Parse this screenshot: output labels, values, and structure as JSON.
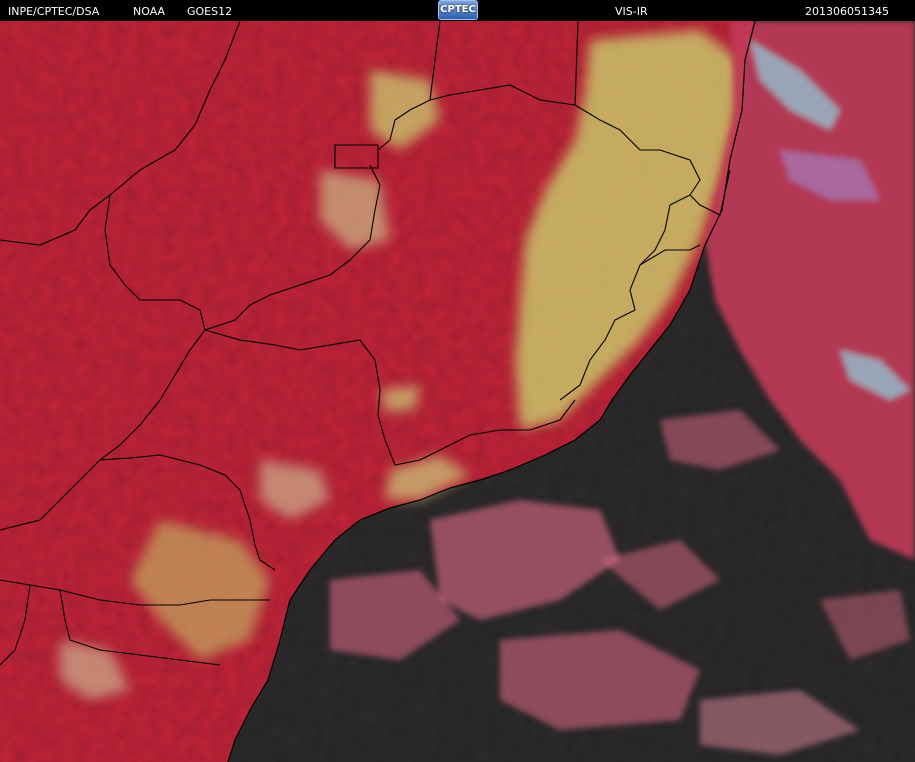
{
  "header": {
    "source": "INPE/CPTEC/DSA",
    "agency": "NOAA",
    "satellite": "GOES12",
    "logo_text": "CPTEC",
    "channel": "VIS-IR",
    "timestamp": "201306051345"
  },
  "colors": {
    "land": "#c4243a",
    "ocean": "#2d2b2b",
    "cloud_yellow": "#c9c46a",
    "cloud_cyan": "#8fd3e0",
    "cloud_pink": "#e06a8a",
    "borders": "#000000"
  }
}
